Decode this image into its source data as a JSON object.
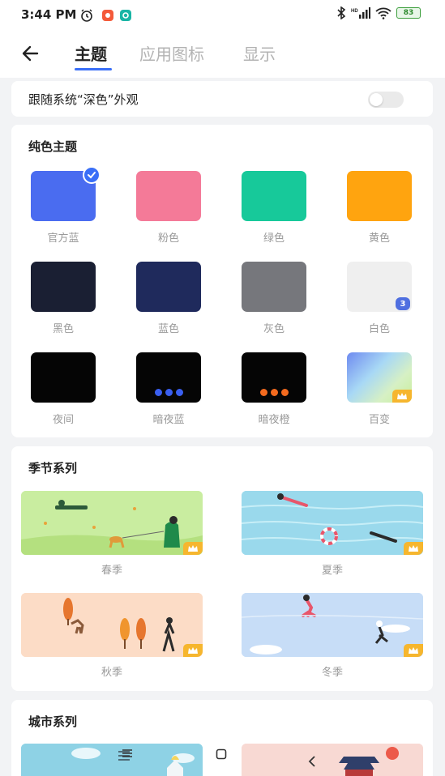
{
  "status_bar": {
    "time": "3:44 PM",
    "battery": "83"
  },
  "header": {
    "tabs": [
      {
        "label": "主题"
      },
      {
        "label": "应用图标"
      },
      {
        "label": "显示"
      }
    ]
  },
  "follow_system": {
    "label": "跟随系统“深色”外观",
    "enabled": false
  },
  "solid_themes": {
    "title": "纯色主题",
    "items": [
      {
        "label": "官方蓝",
        "color": "#4a6cf0",
        "selected": true
      },
      {
        "label": "粉色",
        "color": "#f47a98"
      },
      {
        "label": "绿色",
        "color": "#17c99a"
      },
      {
        "label": "黄色",
        "color": "#ffa40f"
      },
      {
        "label": "黑色",
        "color": "#1a1f33"
      },
      {
        "label": "蓝色",
        "color": "#1f2a5c"
      },
      {
        "label": "灰色",
        "color": "#76777c"
      },
      {
        "label": "白色",
        "color": "#efefef",
        "badge": "3"
      },
      {
        "label": "夜间",
        "color": "#050505"
      },
      {
        "label": "暗夜蓝",
        "color": "#050505",
        "dots_color": "#3a5ff0"
      },
      {
        "label": "暗夜橙",
        "color": "#050505",
        "dots_color": "#f36a1e"
      },
      {
        "label": "百变",
        "color": "gradient",
        "premium": true
      }
    ]
  },
  "seasons": {
    "title": "季节系列",
    "items": [
      {
        "label": "春季"
      },
      {
        "label": "夏季"
      },
      {
        "label": "秋季"
      },
      {
        "label": "冬季"
      }
    ]
  },
  "cities": {
    "title": "城市系列"
  }
}
